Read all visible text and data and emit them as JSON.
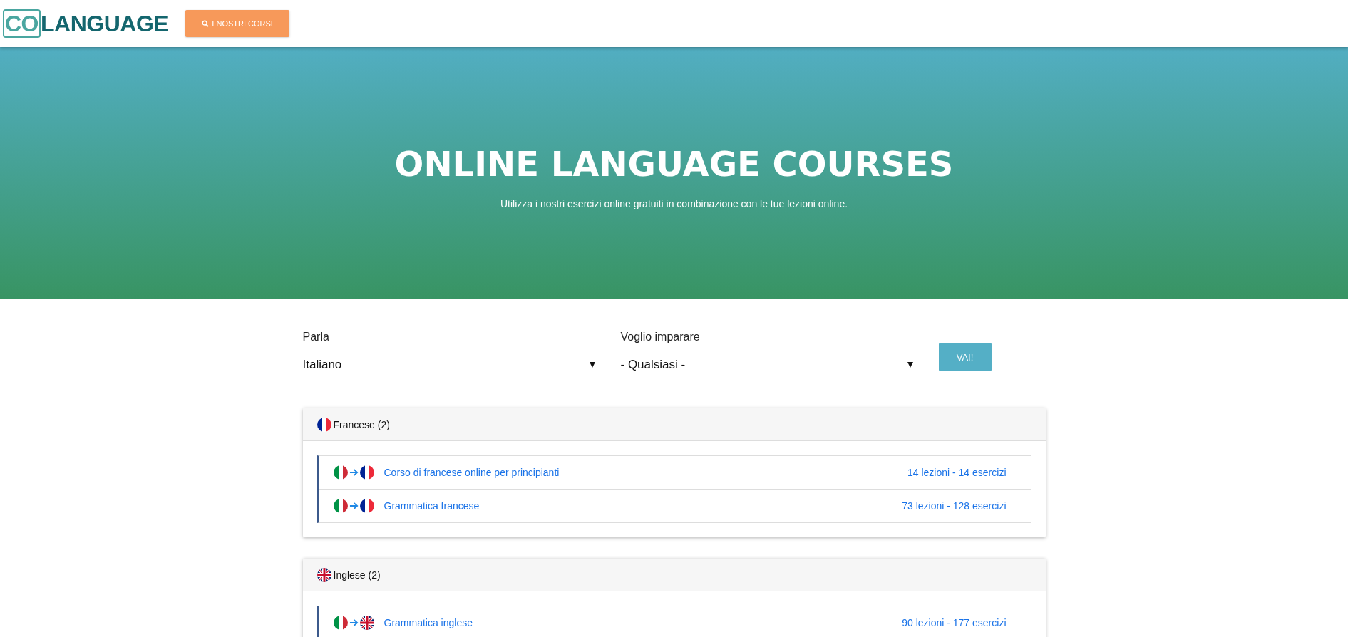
{
  "header": {
    "logo": {
      "boxed": "CO",
      "rest": "LANGUAGE"
    },
    "courses_button": "I NOSTRI CORSI"
  },
  "hero": {
    "title": "ONLINE LANGUAGE COURSES",
    "subtitle": "Utilizza i nostri esercizi online gratuiti in combinazione con le tue lezioni online."
  },
  "form": {
    "fields": [
      {
        "label": "Parla",
        "value": "Italiano"
      },
      {
        "label": "Voglio imparare",
        "value": "- Qualsiasi -"
      }
    ],
    "submit": "VAI!"
  },
  "groups": [
    {
      "title": "Francese (2)",
      "flag": {
        "kind": "fr"
      },
      "courses": [
        {
          "from": {
            "kind": "it"
          },
          "to": {
            "kind": "fr"
          },
          "name": "Corso di francese online per principianti",
          "stats": "14 lezioni - 14 esercizi"
        },
        {
          "from": {
            "kind": "it"
          },
          "to": {
            "kind": "fr"
          },
          "name": "Grammatica francese",
          "stats": "73 lezioni - 128 esercizi"
        }
      ]
    },
    {
      "title": "Inglese (2)",
      "flag": {
        "kind": "gb"
      },
      "courses": [
        {
          "from": {
            "kind": "it"
          },
          "to": {
            "kind": "gb"
          },
          "name": "Grammatica inglese",
          "stats": "90 lezioni - 177 esercizi"
        }
      ]
    }
  ]
}
